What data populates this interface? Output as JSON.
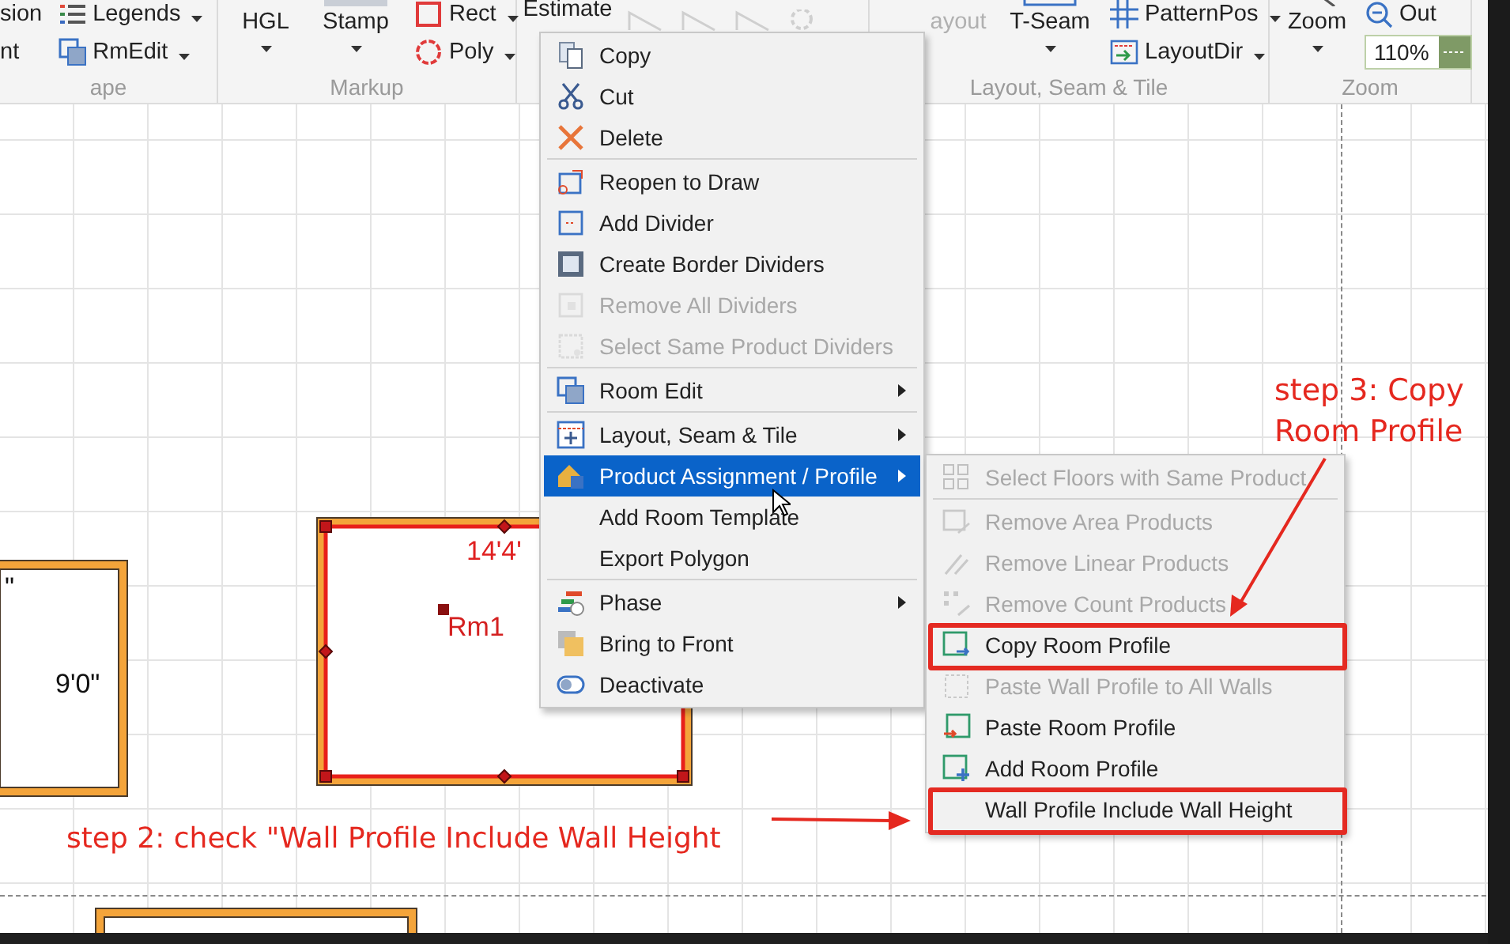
{
  "ribbon": {
    "groups": [
      {
        "label": "ape",
        "columns": [
          [
            {
              "kind": "small",
              "label": "sion",
              "dropdown": false,
              "disabled": false
            },
            {
              "kind": "small",
              "label": "nt",
              "dropdown": false,
              "disabled": false
            }
          ],
          [
            {
              "kind": "small",
              "label": "Legends",
              "dropdown": true,
              "disabled": false
            },
            {
              "kind": "small",
              "label": "RmEdit",
              "dropdown": true,
              "disabled": false
            }
          ]
        ]
      },
      {
        "label": "Markup",
        "columns": [
          [
            {
              "kind": "large",
              "label": "HGL",
              "dropdown": true,
              "disabled": false
            }
          ],
          [
            {
              "kind": "large",
              "label": "Stamp",
              "dropdown": true,
              "disabled": false
            }
          ],
          [
            {
              "kind": "small",
              "label": "Rect",
              "dropdown": true,
              "disabled": false
            },
            {
              "kind": "small",
              "label": "Poly",
              "dropdown": true,
              "disabled": false
            }
          ]
        ]
      },
      {
        "columns": [
          [
            {
              "kind": "large",
              "label": "Estimate",
              "dropdown": false,
              "disabled": false
            }
          ]
        ]
      },
      {
        "label": "Layout, Seam & Tile",
        "columns": [
          [
            {
              "kind": "large",
              "label": "ayout",
              "dropdown": false,
              "disabled": true
            }
          ],
          [
            {
              "kind": "large",
              "label": "T-Seam",
              "dropdown": true,
              "disabled": false
            }
          ],
          [
            {
              "kind": "small",
              "label": "PatternPos",
              "dropdown": true,
              "disabled": false
            },
            {
              "kind": "small",
              "label": "LayoutDir",
              "dropdown": true,
              "disabled": false
            }
          ]
        ]
      },
      {
        "label": "Zoom",
        "columns": [
          [
            {
              "kind": "large",
              "label": "Zoom",
              "dropdown": true,
              "disabled": false
            }
          ],
          [
            {
              "kind": "small",
              "label": "Out",
              "dropdown": false,
              "disabled": false
            },
            {
              "kind": "field",
              "value": "110%"
            }
          ]
        ]
      }
    ]
  },
  "canvas": {
    "rooms": [
      {
        "corner_mark": "\"",
        "dimension": "9'0\"",
        "selected": false
      },
      {
        "name": "Rm1",
        "dimension": "14'4'",
        "selected": true
      },
      {
        "selected": false
      }
    ]
  },
  "context_menu": {
    "sections": [
      [
        {
          "label": "Copy",
          "disabled": false,
          "submenu": false,
          "selected": false
        },
        {
          "label": "Cut",
          "disabled": false,
          "submenu": false,
          "selected": false
        },
        {
          "label": "Delete",
          "disabled": false,
          "submenu": false,
          "selected": false
        }
      ],
      [
        {
          "label": "Reopen to Draw",
          "disabled": false,
          "submenu": false,
          "selected": false
        },
        {
          "label": "Add Divider",
          "disabled": false,
          "submenu": false,
          "selected": false
        },
        {
          "label": "Create Border Dividers",
          "disabled": false,
          "submenu": false,
          "selected": false
        },
        {
          "label": "Remove All Dividers",
          "disabled": true,
          "submenu": false,
          "selected": false
        },
        {
          "label": "Select Same Product Dividers",
          "disabled": true,
          "submenu": false,
          "selected": false
        }
      ],
      [
        {
          "label": "Room Edit",
          "disabled": false,
          "submenu": true,
          "selected": false
        }
      ],
      [
        {
          "label": "Layout, Seam & Tile",
          "disabled": false,
          "submenu": true,
          "selected": false
        },
        {
          "label": "Product Assignment / Profile",
          "disabled": false,
          "submenu": true,
          "selected": true
        },
        {
          "label": "Add Room Template",
          "disabled": false,
          "submenu": false,
          "selected": false
        },
        {
          "label": "Export Polygon",
          "disabled": false,
          "submenu": false,
          "selected": false
        }
      ],
      [
        {
          "label": "Phase",
          "disabled": false,
          "submenu": true,
          "selected": false
        },
        {
          "label": "Bring to Front",
          "disabled": false,
          "submenu": false,
          "selected": false
        },
        {
          "label": "Deactivate",
          "disabled": false,
          "submenu": false,
          "selected": false
        }
      ]
    ]
  },
  "submenu": {
    "sections": [
      [
        {
          "label": "Select Floors with Same Product",
          "disabled": true,
          "highlighted": false
        }
      ],
      [
        {
          "label": "Remove Area Products",
          "disabled": true,
          "highlighted": false
        },
        {
          "label": "Remove Linear Products",
          "disabled": true,
          "highlighted": false
        },
        {
          "label": "Remove Count Products",
          "disabled": true,
          "highlighted": false
        },
        {
          "label": "Copy Room Profile",
          "disabled": false,
          "highlighted": true
        },
        {
          "label": "Paste Wall Profile to All Walls",
          "disabled": true,
          "highlighted": false
        },
        {
          "label": "Paste Room Profile",
          "disabled": false,
          "highlighted": false
        },
        {
          "label": "Add Room Profile",
          "disabled": false,
          "highlighted": false
        },
        {
          "label": "Wall Profile Include Wall Height",
          "disabled": false,
          "highlighted": true
        }
      ]
    ]
  },
  "annotations": [
    {
      "text": "step 3: Copy Room Profile"
    },
    {
      "text": "step 2: check \"Wall Profile Include Wall Height"
    }
  ]
}
